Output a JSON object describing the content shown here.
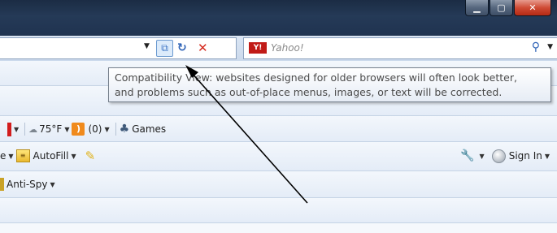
{
  "search": {
    "placeholder": "Yahoo!",
    "logo_text": "Y!"
  },
  "tooltip": {
    "line1": "Compatibility View: websites designed for older browsers will often look better,",
    "line2": "and problems such as out-of-place menus, images, or text will be corrected."
  },
  "toolbar1": {
    "weather": "75°F",
    "feeds": "(0)",
    "games": "Games"
  },
  "toolbar2": {
    "left_fragment": "e",
    "autofill": "AutoFill",
    "sign_in": "Sign In"
  },
  "toolbar3": {
    "antispy": "Anti-Spy"
  },
  "icons": {
    "minimize": "minimize-icon",
    "maximize": "maximize-icon",
    "close": "close-icon",
    "compatibility": "compatibility-view-icon",
    "refresh": "refresh-icon",
    "stop": "stop-icon",
    "search": "search-icon",
    "weather": "cloud-icon",
    "rss": "rss-icon",
    "games": "games-icon",
    "autofill": "autofill-icon",
    "pencil": "highlighter-icon",
    "wrench": "wrench-icon",
    "signin": "user-circle-icon"
  },
  "colors": {
    "titlebar": "#1f3350",
    "close_button": "#cf4b35",
    "toolbar": "#e4ecf7",
    "tooltip_border": "#76808c"
  }
}
